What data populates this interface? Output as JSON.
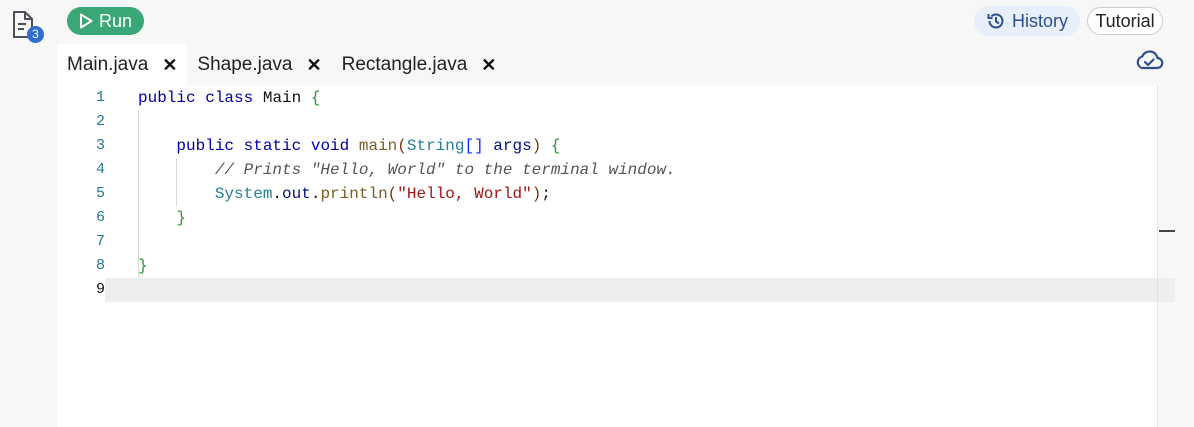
{
  "files": {
    "badge_count": "3",
    "icon": "file-icon"
  },
  "toolbar": {
    "run_label": "Run",
    "history_label": "History",
    "tutorial_label": "Tutorial"
  },
  "tabs": [
    {
      "label": "Main.java",
      "active": true
    },
    {
      "label": "Shape.java",
      "active": false
    },
    {
      "label": "Rectangle.java",
      "active": false
    }
  ],
  "editor": {
    "lines": [
      {
        "number": "1",
        "text": "public class Main {"
      },
      {
        "number": "2",
        "text": ""
      },
      {
        "number": "3",
        "text": "    public static void main(String[] args) {"
      },
      {
        "number": "4",
        "text": "        // Prints \"Hello, World\" to the terminal window."
      },
      {
        "number": "5",
        "text": "        System.out.println(\"Hello, World\");"
      },
      {
        "number": "6",
        "text": "    }"
      },
      {
        "number": "7",
        "text": ""
      },
      {
        "number": "8",
        "text": "}"
      },
      {
        "number": "9",
        "text": ""
      }
    ],
    "current_line": "9"
  },
  "colors": {
    "run": "#3aa776",
    "history_bg": "#e7effa",
    "badge": "#2f6fd1"
  }
}
